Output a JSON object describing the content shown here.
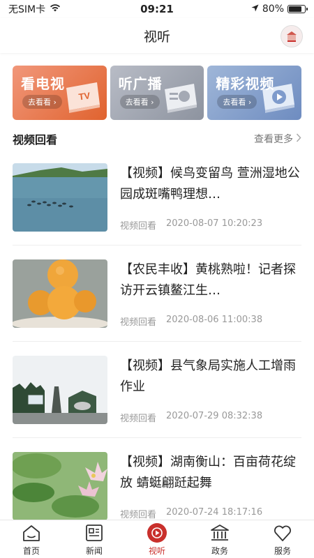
{
  "status_bar": {
    "carrier": "无SIM卡",
    "time": "09:21",
    "battery": "80%",
    "battery_level": 0.8
  },
  "header": {
    "title": "视听"
  },
  "cards": [
    {
      "label": "看电视",
      "action": "去看看",
      "icon": "tv-icon",
      "deco": "TV"
    },
    {
      "label": "听广播",
      "action": "去看看",
      "icon": "radio-icon"
    },
    {
      "label": "精彩视频",
      "action": "去看看",
      "icon": "play-icon"
    }
  ],
  "section": {
    "title": "视频回看",
    "more": "查看更多"
  },
  "items": [
    {
      "title": "【视频】候鸟变留鸟 萱洲湿地公园成斑嘴鸭理想…",
      "tag": "视频回看",
      "date": "2020-08-07 10:20:23"
    },
    {
      "title": "【农民丰收】黄桃熟啦！记者探访开云镇鳌江生…",
      "tag": "视频回看",
      "date": "2020-08-06 11:00:38"
    },
    {
      "title": "【视频】县气象局实施人工增雨作业",
      "tag": "视频回看",
      "date": "2020-07-29 08:32:38"
    },
    {
      "title": "【视频】湖南衡山：百亩荷花绽放 蜻蜓翩跹起舞",
      "tag": "视频回看",
      "date": "2020-07-24 18:17:16"
    }
  ],
  "tabs": [
    {
      "label": "首页",
      "icon": "home-icon"
    },
    {
      "label": "新闻",
      "icon": "news-icon"
    },
    {
      "label": "视听",
      "icon": "play-circle-icon",
      "active": true
    },
    {
      "label": "政务",
      "icon": "government-icon"
    },
    {
      "label": "服务",
      "icon": "heart-icon"
    }
  ],
  "colors": {
    "accent": "#c9302c",
    "tv_card": "#e0632f",
    "radio_card": "#9a9fab",
    "video_card": "#7b97c8"
  }
}
